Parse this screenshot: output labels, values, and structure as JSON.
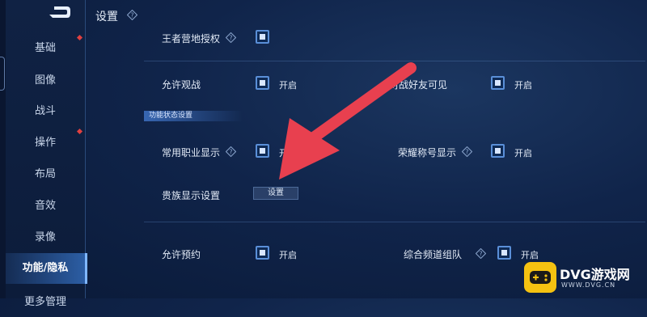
{
  "header": {
    "title": "设置"
  },
  "sidebar": {
    "items": [
      {
        "label": "基础"
      },
      {
        "label": "图像"
      },
      {
        "label": "战斗"
      },
      {
        "label": "操作"
      },
      {
        "label": "布局"
      },
      {
        "label": "音效"
      },
      {
        "label": "录像"
      },
      {
        "label": "功能/隐私"
      },
      {
        "label": "更多管理"
      }
    ],
    "active_index": 7
  },
  "settings": {
    "camp_auth": {
      "label": "王者营地授权",
      "checked": true
    },
    "allow_spectate": {
      "label": "允许观战",
      "checked": true,
      "state": "开启"
    },
    "friend_visible": {
      "label": "对战好友可见",
      "checked": true,
      "state": "开启"
    },
    "section_title": "功能状态设置",
    "common_job": {
      "label": "常用职业显示",
      "checked": true,
      "state": "开启"
    },
    "honor_title": {
      "label": "荣耀称号显示",
      "checked": true,
      "state": "开启"
    },
    "noble_display": {
      "label": "贵族显示设置",
      "button": "设置"
    },
    "allow_reserve": {
      "label": "允许预约",
      "checked": true,
      "state": "开启"
    },
    "channel_team": {
      "label": "综合频道组队",
      "checked": true,
      "state": "开启"
    }
  },
  "watermark": {
    "title": "DVG游戏网",
    "url": "WWW.DVG.CN"
  },
  "colors": {
    "accent": "#5a8fd8",
    "arrow": "#e8404f",
    "background": "#10244a",
    "logo": "#f5c211"
  }
}
